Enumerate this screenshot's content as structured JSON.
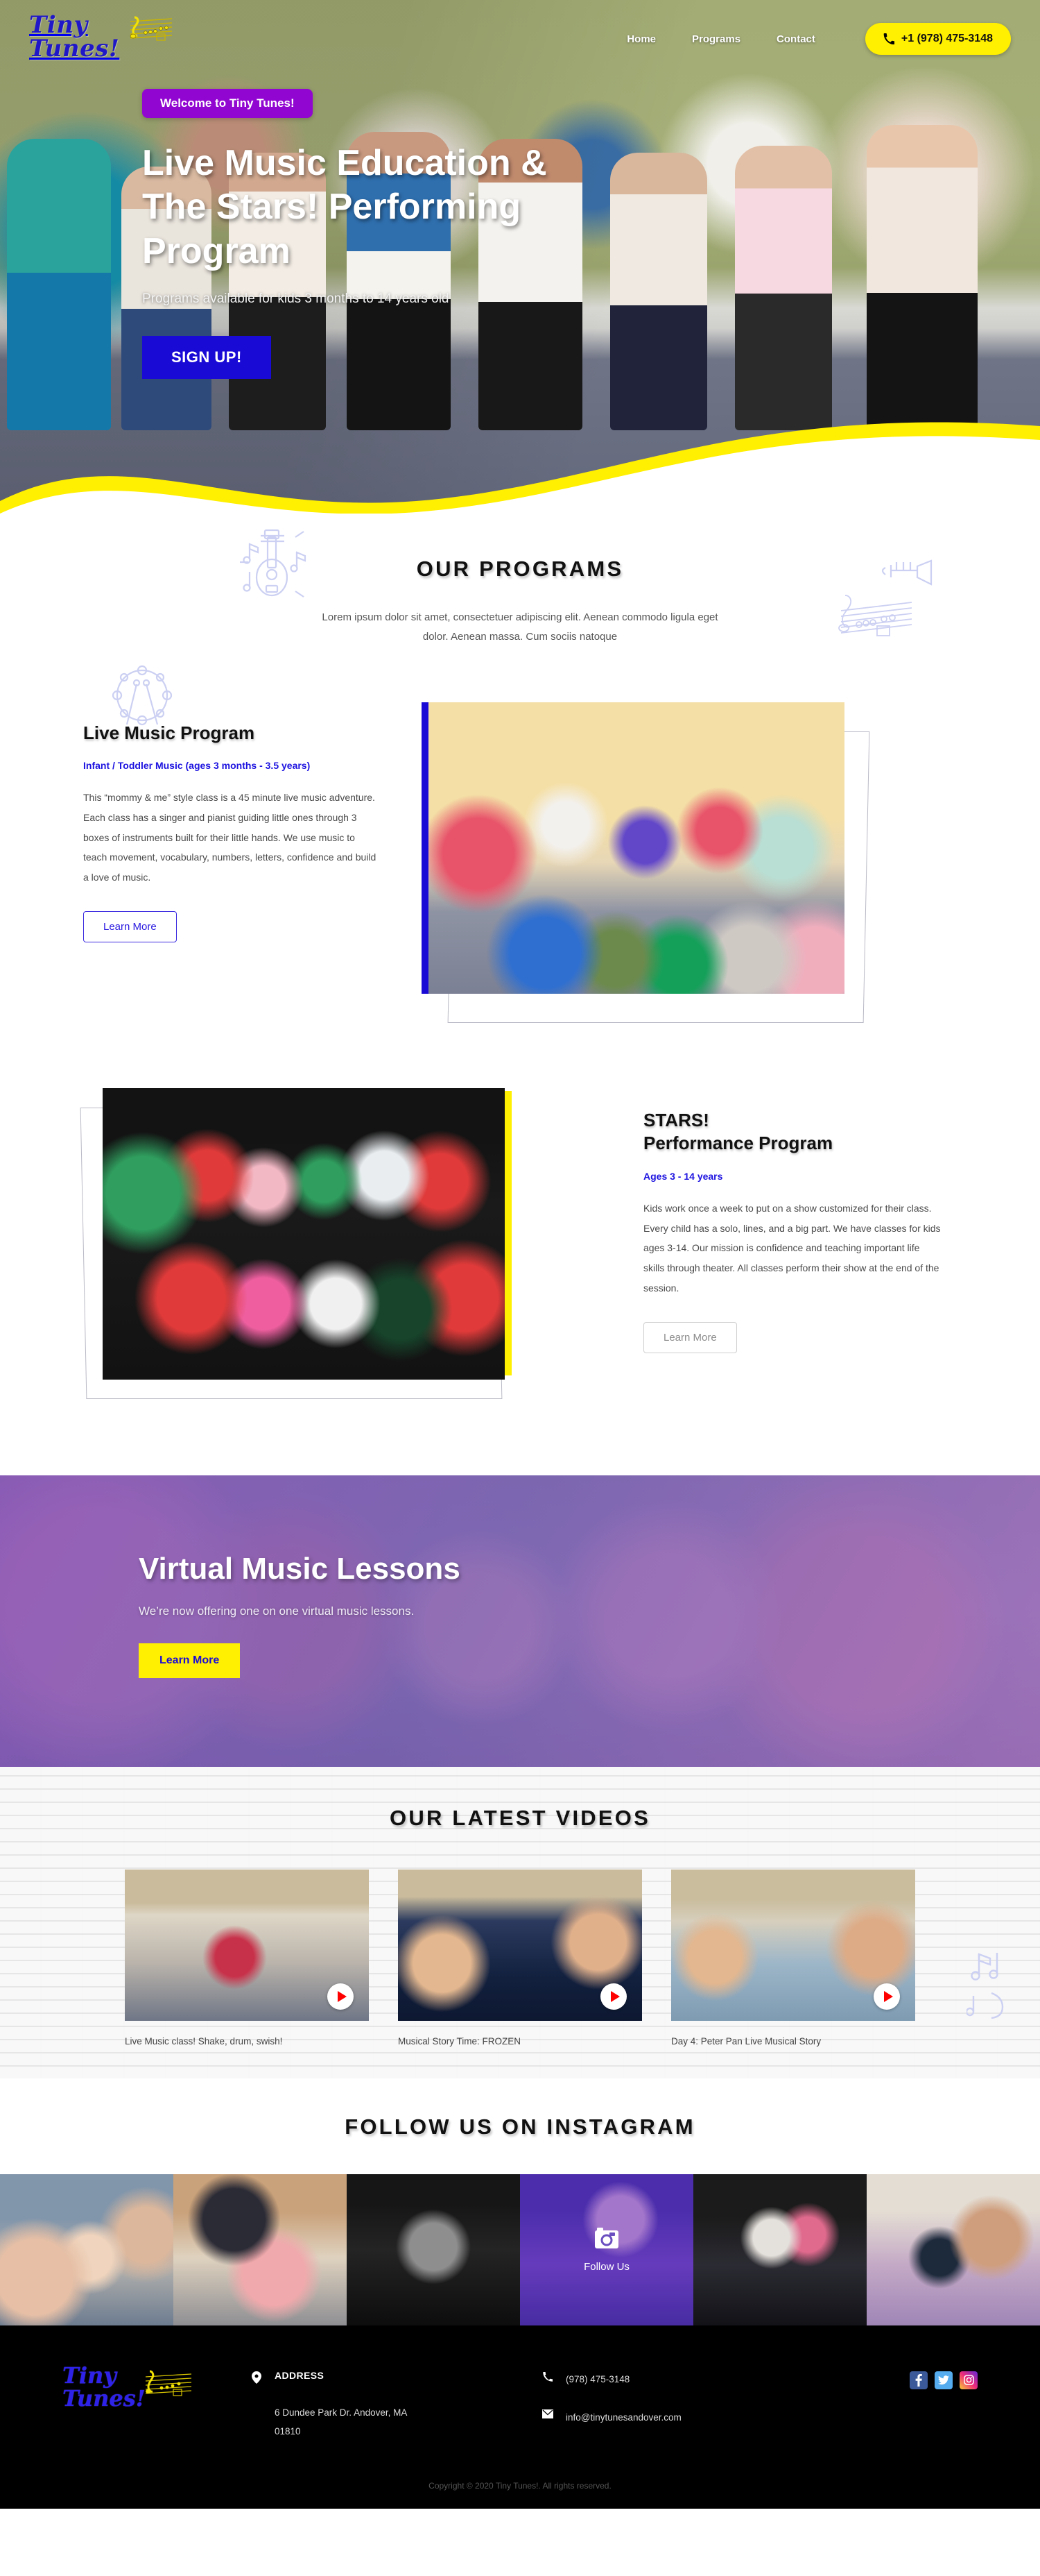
{
  "brand": {
    "line1": "Tiny",
    "line2": "Tunes!"
  },
  "nav": {
    "items": [
      {
        "label": "Home"
      },
      {
        "label": "Programs"
      },
      {
        "label": "Contact"
      }
    ],
    "phone": "+1 (978) 475-3148"
  },
  "hero": {
    "badge": "Welcome to Tiny Tunes!",
    "title": "Live Music Education & The Stars! Performing Program",
    "subtitle": "Programs available for kids 3 months to 14 years old",
    "cta": "SIGN UP!"
  },
  "programs": {
    "title": "OUR PROGRAMS",
    "lead": "Lorem ipsum dolor sit amet, consectetuer adipiscing elit. Aenean commodo ligula eget dolor. Aenean massa. Cum sociis natoque",
    "live": {
      "title": "Live Music Program",
      "ages": "Infant / Toddler Music (ages 3 months - 3.5 years)",
      "body": "This “mommy & me” style class is a 45 minute live music adventure. Each class has a singer and pianist guiding little ones through 3 boxes of instruments built for their little hands. We use music to teach movement, vocabulary, numbers,  letters, confidence and build a love of music.",
      "cta": "Learn More"
    },
    "stars": {
      "title_line1": "STARS!",
      "title_line2": "Performance Program",
      "ages": "Ages 3 - 14 years",
      "body": "Kids work once a week to put on a show customized for their class. Every child has a solo, lines, and a big part. We have classes for kids ages 3-14. Our mission is confidence and teaching important life skills through theater. All classes perform their show at the end of the session.",
      "cta": "Learn More"
    }
  },
  "virtual": {
    "title": "Virtual Music Lessons",
    "subtitle": "We’re now offering one on one virtual music lessons.",
    "cta": "Learn More"
  },
  "videos": {
    "title": "OUR LATEST VIDEOS",
    "items": [
      {
        "caption": "Live Music class! Shake, drum, swish!"
      },
      {
        "caption": "Musical Story Time: FROZEN"
      },
      {
        "caption": "Day 4: Peter Pan Live Musical Story"
      }
    ]
  },
  "instagram": {
    "title": "FOLLOW US ON INSTAGRAM",
    "follow_label": "Follow Us",
    "cells": 6
  },
  "footer": {
    "address_label": "ADDRESS",
    "address_value": "6 Dundee Park Dr. Andover, MA 01810",
    "phone": "(978) 475-3148",
    "email": "info@tinytunesandover.com",
    "social": [
      {
        "name": "facebook"
      },
      {
        "name": "twitter"
      },
      {
        "name": "instagram"
      }
    ],
    "copyright": "Copyright © 2020 Tiny Tunes!. All rights reserved."
  },
  "colors": {
    "yellow": "#ffef00",
    "blue": "#1a0ad6",
    "purple": "#9106d1",
    "deco": "#ccd0f2"
  }
}
